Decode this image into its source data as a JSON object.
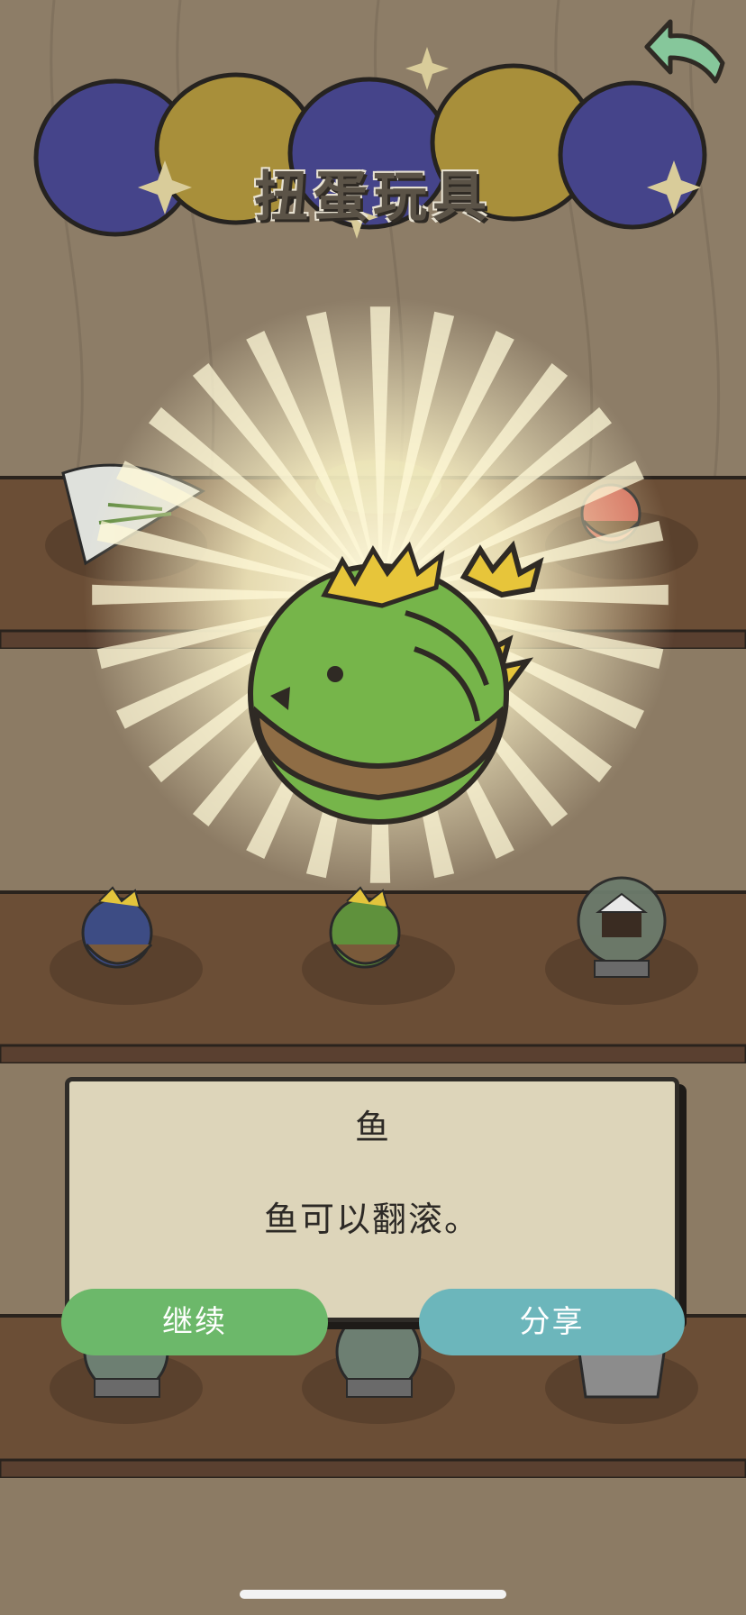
{
  "header": {
    "title": "扭蛋玩具"
  },
  "prize": {
    "name": "鱼",
    "description": "鱼可以翻滚。"
  },
  "buttons": {
    "continue": "继续",
    "share": "分享"
  },
  "icons": {
    "back": "back-arrow-icon"
  },
  "colors": {
    "continue_button": "#6cb86a",
    "share_button": "#6cb6bb",
    "dialog_bg": "#ddd5ba"
  }
}
